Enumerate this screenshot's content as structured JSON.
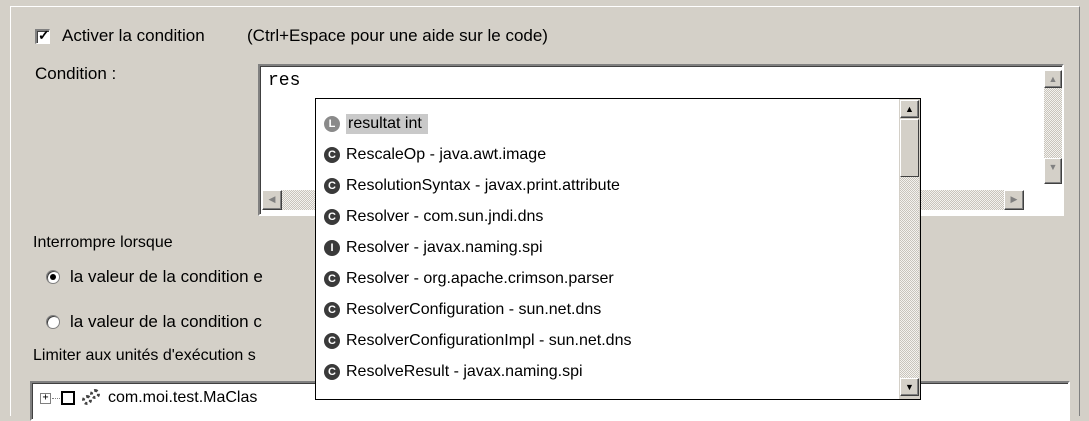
{
  "enable_condition": {
    "checked": true,
    "label": "Activer la condition",
    "hint": "(Ctrl+Espace pour une aide sur le code)"
  },
  "condition": {
    "label": "Condition :",
    "value": "res"
  },
  "suspend": {
    "label": "Interrompre lorsque",
    "options": [
      {
        "label": "la valeur de la condition e",
        "selected": true
      },
      {
        "label": "la valeur de la condition c",
        "selected": false
      }
    ]
  },
  "thread_limit": {
    "label": "Limiter aux unités d'exécution s"
  },
  "thread_tree": {
    "row_label": "com.moi.test.MaClas"
  },
  "autocomplete": {
    "items": [
      {
        "icon": "local-variable-icon",
        "badge": "L",
        "text": "resultat    int",
        "selected": true
      },
      {
        "icon": "class-icon",
        "badge": "C",
        "text": "RescaleOp - java.awt.image",
        "selected": false
      },
      {
        "icon": "class-icon",
        "badge": "C",
        "text": "ResolutionSyntax - javax.print.attribute",
        "selected": false
      },
      {
        "icon": "class-icon",
        "badge": "C",
        "text": "Resolver - com.sun.jndi.dns",
        "selected": false
      },
      {
        "icon": "interface-icon",
        "badge": "I",
        "text": "Resolver - javax.naming.spi",
        "selected": false
      },
      {
        "icon": "class-icon",
        "badge": "C",
        "text": "Resolver - org.apache.crimson.parser",
        "selected": false
      },
      {
        "icon": "class-icon",
        "badge": "C",
        "text": "ResolverConfiguration - sun.net.dns",
        "selected": false
      },
      {
        "icon": "class-icon",
        "badge": "C",
        "text": "ResolverConfigurationImpl - sun.net.dns",
        "selected": false
      },
      {
        "icon": "class-icon",
        "badge": "C",
        "text": "ResolveResult - javax.naming.spi",
        "selected": false
      }
    ]
  },
  "glyphs": {
    "check": "✓",
    "up": "▲",
    "down": "▼",
    "left": "◀",
    "right": "▶",
    "plus": "+"
  }
}
